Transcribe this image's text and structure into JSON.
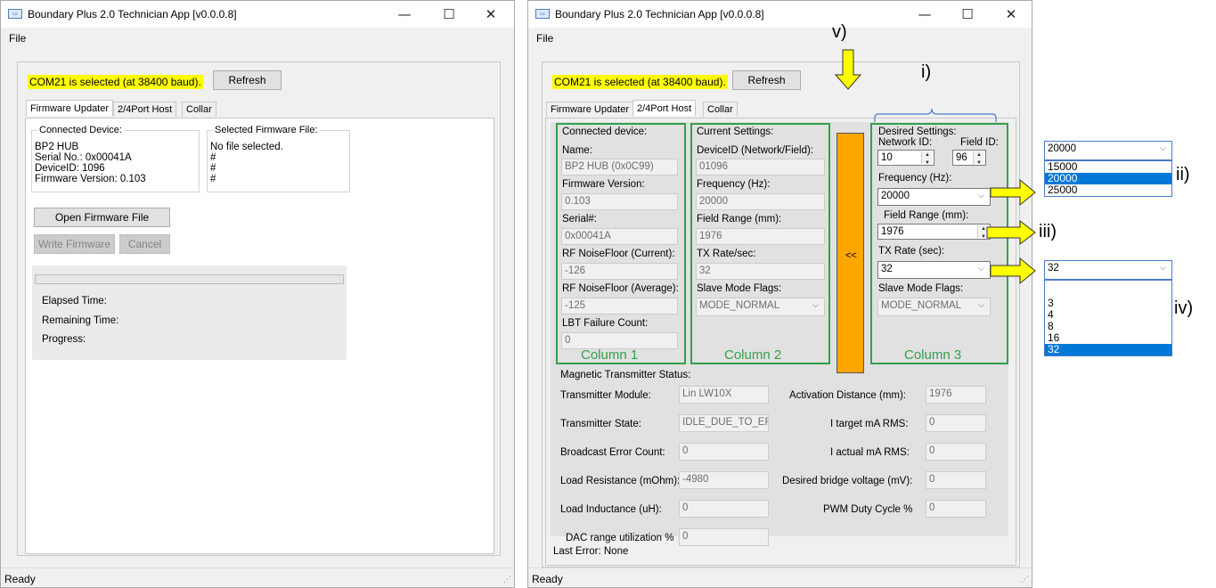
{
  "window_title": "Boundary Plus 2.0 Technician App [v0.0.0.8]",
  "menu_file": "File",
  "status_ready": "Ready",
  "com_status": "COM21 is selected (at 38400 baud).",
  "refresh_label": "Refresh",
  "tabs": [
    "Firmware Updater",
    "2/4Port Host",
    "Collar"
  ],
  "left": {
    "connected_device_label": "Connected Device:",
    "device_lines": [
      "BP2 HUB",
      "Serial No.: 0x00041A",
      "DeviceID: 1096",
      "Firmware Version: 0.103"
    ],
    "selected_file_label": "Selected Firmware File:",
    "file_lines": [
      "No file selected.",
      "#",
      "#",
      "#"
    ],
    "open_label": "Open Firmware File",
    "write_label": "Write Firmware",
    "cancel_label": "Cancel",
    "elapsed_label": "Elapsed Time:",
    "remaining_label": "Remaining Time:",
    "progress_label": "Progress:"
  },
  "right": {
    "col1": {
      "header": "Connected device:",
      "name_label": "Name:",
      "name_value": "BP2 HUB (0x0C99)",
      "fw_label": "Firmware Version:",
      "fw_value": "0.103",
      "serial_label": "Serial#:",
      "serial_value": "0x00041A",
      "rf_current_label": "RF NoiseFloor (Current):",
      "rf_current_value": "-126",
      "rf_avg_label": "RF NoiseFloor (Average):",
      "rf_avg_value": "-125",
      "lbt_label": "LBT Failure Count:",
      "lbt_value": "0"
    },
    "col2": {
      "header": "Current Settings:",
      "deviceid_label": "DeviceID (Network/Field):",
      "deviceid_value": "01096",
      "freq_label": "Frequency (Hz):",
      "freq_value": "20000",
      "range_label": "Field Range (mm):",
      "range_value": "1976",
      "tx_label": "TX Rate/sec:",
      "tx_value": "32",
      "slave_label": "Slave Mode Flags:",
      "slave_value": "MODE_NORMAL"
    },
    "copy_button": "<<",
    "col3": {
      "header": "Desired Settings:",
      "network_label": "Network ID:",
      "network_value": "10",
      "field_label": "Field ID:",
      "field_value": "96",
      "freq_label": "Frequency (Hz):",
      "freq_value": "20000",
      "range_label": "Field Range (mm):",
      "range_value": "1976",
      "tx_label": "TX Rate (sec):",
      "tx_value": "32",
      "slave_label": "Slave Mode Flags:",
      "slave_value": "MODE_NORMAL"
    },
    "column_labels": [
      "Column 1",
      "Column 2",
      "Column 3"
    ],
    "magnetic": {
      "header": "Magnetic Transmitter Status:",
      "rows_left": [
        {
          "label": "Transmitter Module:",
          "value": "Lin LW10X"
        },
        {
          "label": "Transmitter State:",
          "value": "IDLE_DUE_TO_EF"
        },
        {
          "label": "Broadcast Error Count:",
          "value": "0"
        },
        {
          "label": "Load Resistance (mOhm):",
          "value": "-4980"
        },
        {
          "label": "Load Inductance (uH):",
          "value": "0"
        },
        {
          "label": "DAC range utilization %",
          "value": "0"
        }
      ],
      "rows_right": [
        {
          "label": "Activation Distance (mm):",
          "value": "1976"
        },
        {
          "label": "I target mA RMS:",
          "value": "0"
        },
        {
          "label": "I actual mA RMS:",
          "value": "0"
        },
        {
          "label": "Desired bridge voltage (mV):",
          "value": "0"
        },
        {
          "label": "PWM Duty Cycle %",
          "value": "0"
        }
      ]
    },
    "last_error": "Last Error: None"
  },
  "annotations": {
    "i": "i)",
    "ii": "ii)",
    "iii": "iii)",
    "iv": "iv)",
    "v": "v)"
  },
  "freq_dropdown": {
    "selected": "20000",
    "options": [
      "15000",
      "20000",
      "25000"
    ],
    "highlight_index": 1
  },
  "tx_dropdown": {
    "selected": "32",
    "options": [
      "3",
      "4",
      "8",
      "16",
      "32"
    ],
    "highlight_index": 4
  },
  "colors": {
    "highlight": "#ffff00",
    "green": "#33a04a",
    "orange": "#ffa500",
    "arrow": "#ffff00",
    "select_blue": "#0078d7"
  }
}
